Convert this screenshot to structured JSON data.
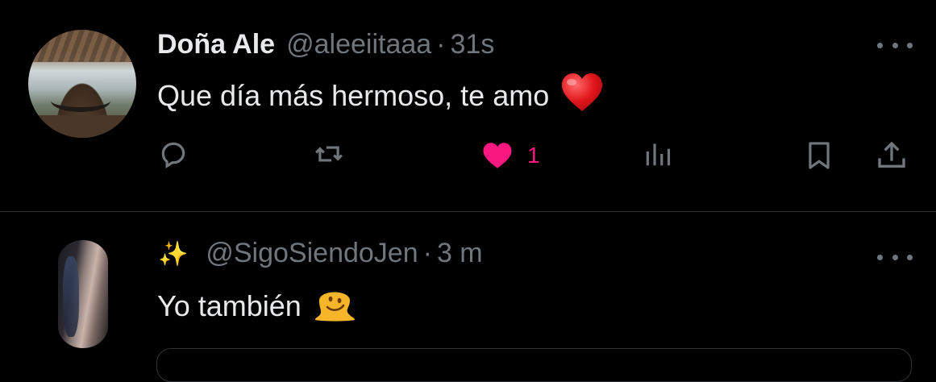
{
  "tweet": {
    "author_name": "Doña Ale",
    "handle": "@aleeiitaaa",
    "separator": "·",
    "time": "31s",
    "text": "Que día más hermoso, te amo",
    "text_emoji": "heart-emoji",
    "actions": {
      "reply_icon": "reply-icon",
      "retweet_icon": "retweet-icon",
      "like_icon": "heart-filled-icon",
      "like_count": "1",
      "like_color": "#f91880",
      "views_icon": "views-icon",
      "bookmark_icon": "bookmark-icon",
      "share_icon": "share-icon"
    }
  },
  "reply": {
    "author_name": "✨",
    "handle": "@SigoSiendoJen",
    "separator": "·",
    "time": "3 m",
    "text": "Yo también",
    "text_emoji": "melting-face-emoji"
  },
  "colors": {
    "background": "#000000",
    "primary_text": "#e7e9ea",
    "secondary_text": "#71767b",
    "divider": "#2f3336"
  }
}
